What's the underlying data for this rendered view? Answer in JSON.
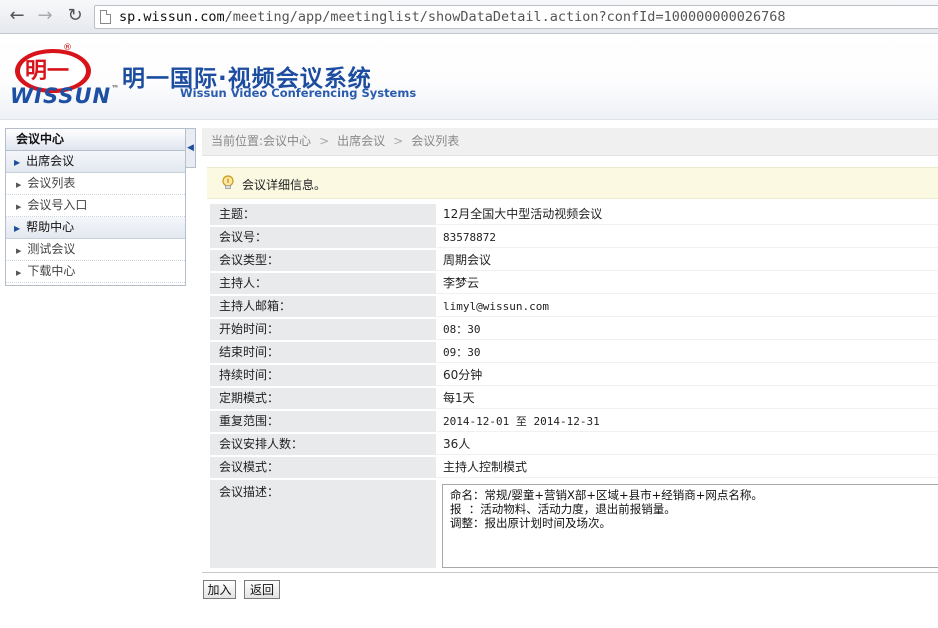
{
  "browser": {
    "url_host": "sp.wissun.com",
    "url_path": "/meeting/app/meetinglist/showDataDetail.action?confId=100000000026768"
  },
  "header": {
    "logo_cn": "明一",
    "logo_wordmark": "WISSUN",
    "brand_cn": "明一国际·视频会议系统",
    "brand_en": "Wissun Video Conferencing Systems"
  },
  "sidebar": {
    "title": "会议中心",
    "groups": [
      {
        "label": "出席会议",
        "items": [
          "会议列表",
          "会议号入口"
        ]
      },
      {
        "label": "帮助中心",
        "items": [
          "测试会议",
          "下载中心"
        ]
      }
    ]
  },
  "breadcrumb": {
    "prefix": "当前位置:",
    "items": [
      "会议中心",
      "出席会议",
      "会议列表"
    ]
  },
  "tip": {
    "text": "会议详细信息。"
  },
  "detail": {
    "rows": [
      {
        "label": "主题：",
        "value": "12月全国大中型活动视频会议"
      },
      {
        "label": "会议号：",
        "value": "83578872"
      },
      {
        "label": "会议类型：",
        "value": "周期会议"
      },
      {
        "label": "主持人：",
        "value": "李梦云"
      },
      {
        "label": "主持人邮箱：",
        "value": "limyl@wissun.com"
      },
      {
        "label": "开始时间：",
        "value": "08：30"
      },
      {
        "label": "结束时间：",
        "value": "09：30"
      },
      {
        "label": "持续时间：",
        "value": "60分钟"
      },
      {
        "label": "定期模式：",
        "value": "每1天"
      },
      {
        "label": "重复范围：",
        "value": "2014-12-01 至 2014-12-31"
      },
      {
        "label": "会议安排人数：",
        "value": "36人"
      },
      {
        "label": "会议模式：",
        "value": "主持人控制模式"
      }
    ],
    "description_label": "会议描述：",
    "description": "命名：常规/婴童+营销X部+区域+县市+经销商+网点名称。\n报  ：活动物料、活动力度，退出前报销量。\n调整：报出原计划时间及场次。"
  },
  "buttons": {
    "join": "加入",
    "back": "返回"
  }
}
